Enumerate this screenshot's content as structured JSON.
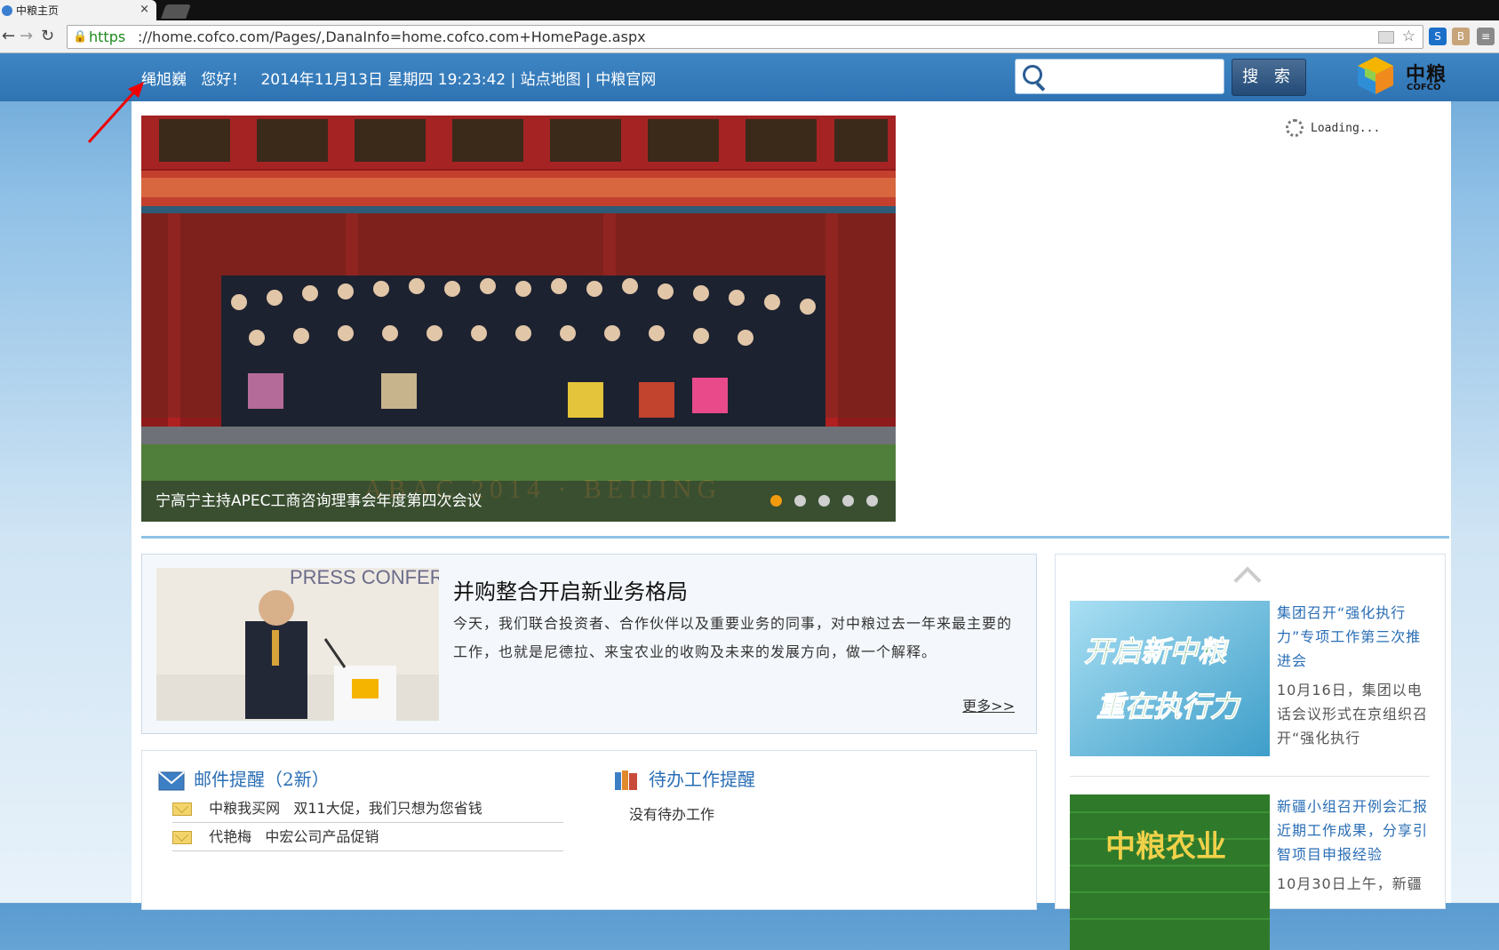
{
  "browser": {
    "tab_title": "中粮主页",
    "tab_close": "×",
    "url_scheme": "https",
    "url_rest": "://home.cofco.com/Pages/,DanaInfo=home.cofco.com+HomePage.aspx",
    "nav_back": "←",
    "nav_forward": "→",
    "nav_reload": "↻"
  },
  "header": {
    "user_name": "绳旭巍",
    "greeting": "您好！",
    "datetime": "2014年11月13日 星期四 19:23:42",
    "sep1": "|",
    "sitemap": "站点地图",
    "sep2": "|",
    "official_site": "中粮官网",
    "search_placeholder": "",
    "search_button": "搜 索",
    "logo_cn": "中粮",
    "logo_en": "COFCO",
    "brand_color": "#2f73b3"
  },
  "slider": {
    "caption": "宁高宁主持APEC工商咨询理事会年度第四次会议",
    "watermark": "ABAC 2014 · BEIJING",
    "dot_count": 5,
    "active_dot": 0
  },
  "loading_text": "Loading...",
  "feature": {
    "title": "并购整合开启新业务格局",
    "text": "今天，我们联合投资者、合作伙伴以及重要业务的同事，对中粮过去一年来最主要的工作，也就是尼德拉、来宝农业的收购及未来的发展方向，做一个解释。",
    "more": "更多>>",
    "photo_text": "PRESS CONFERENCE CLOSE OF OVE"
  },
  "news": [
    {
      "img_text_1": "开启新中粮",
      "img_text_2": "重在执行力",
      "title": "集团召开“强化执行力”专项工作第三次推进会",
      "excerpt": "10月16日，集团以电话会议形式在京组织召开“强化执行"
    },
    {
      "img_text_1": "中粮农业",
      "img_text_2": "",
      "title": "新疆小组召开例会汇报近期工作成果，分享引智项目申报经验",
      "excerpt": "10月30日上午，新疆"
    }
  ],
  "mail": {
    "title": "邮件提醒（2新）",
    "items": [
      {
        "sender": "中粮我买网",
        "subject": "双11大促，我们只想为您省钱"
      },
      {
        "sender": "代艳梅",
        "subject": "中宏公司产品促销"
      }
    ]
  },
  "todo": {
    "title": "待办工作提醒",
    "empty_text": "没有待办工作"
  }
}
